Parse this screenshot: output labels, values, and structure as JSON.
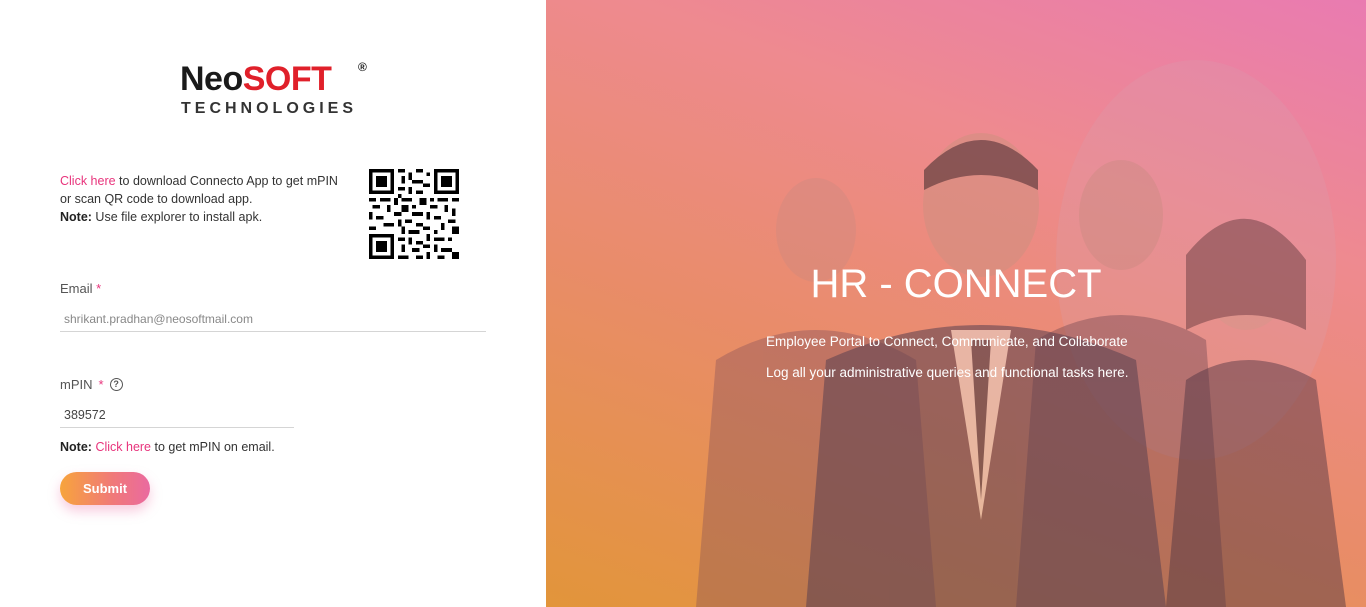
{
  "logo": {
    "main_dark": "Neo",
    "main_red": "SOFT",
    "registered": "®",
    "sub": "TECHNOLOGIES"
  },
  "download": {
    "link": "Click here",
    "text": " to download Connecto App to get mPIN or scan QR code to download app.",
    "note_label": "Note:",
    "note_text": " Use file explorer to install apk."
  },
  "form": {
    "email_label": "Email",
    "required_mark": "*",
    "email_value": "shrikant.pradhan@neosoftmail.com",
    "mpin_label": "mPIN",
    "help_icon": "?",
    "mpin_value": "389572",
    "mpin_note_label": "Note:",
    "mpin_note_link": "Click here",
    "mpin_note_text": " to get mPIN on email.",
    "submit_label": "Submit"
  },
  "hero": {
    "title": "HR - CONNECT",
    "line1": "Employee Portal to Connect, Communicate, and Collaborate",
    "line2": "Log all your administrative queries and functional tasks here."
  },
  "colors": {
    "accent": "#e8347c",
    "brand_red": "#e0202a"
  },
  "icons": {
    "qr": "qr-code-icon",
    "help": "question-circle-icon"
  }
}
